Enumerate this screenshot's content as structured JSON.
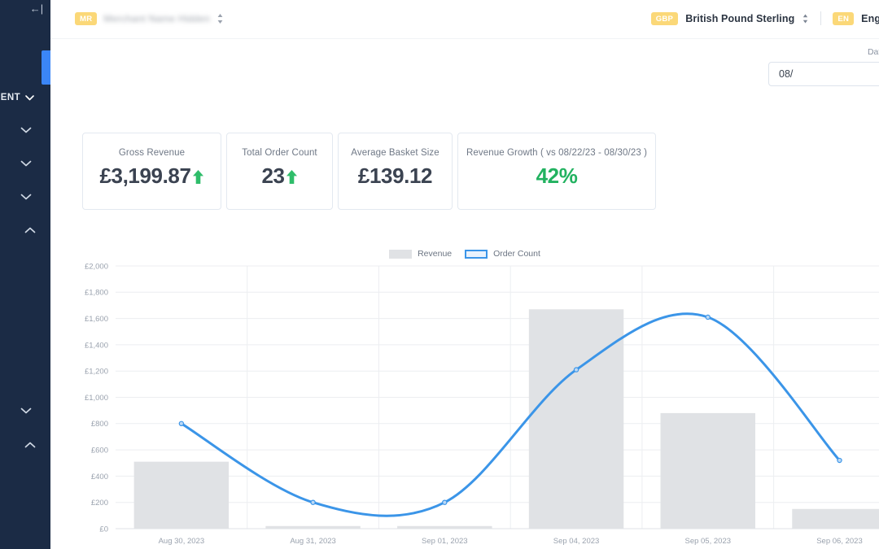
{
  "sidebar": {
    "collapse_icon": "collapse-sidebar-icon",
    "section_label": "ENT",
    "items": [
      {
        "name": "management-section",
        "chevron": "chevron-down"
      },
      {
        "name": "nav-group-2",
        "chevron": "chevron-down"
      },
      {
        "name": "nav-group-3",
        "chevron": "chevron-down"
      },
      {
        "name": "nav-group-4",
        "chevron": "chevron-down"
      },
      {
        "name": "nav-group-5",
        "chevron": "chevron-up"
      },
      {
        "name": "nav-group-6",
        "chevron": "chevron-down"
      },
      {
        "name": "nav-group-7",
        "chevron": "chevron-up"
      }
    ],
    "accent_color": "#3b86f7",
    "background_color": "#1b2b45"
  },
  "topbar": {
    "merchant_badge": "MR",
    "merchant_name": "Merchant Name Hidden",
    "currency_badge": "GBP",
    "currency_label": "British Pound Sterling",
    "language_badge": "EN",
    "language_label": "English"
  },
  "filters": {
    "date_range_label": "Date Range",
    "date_range_value": "08/"
  },
  "kpis": [
    {
      "title": "Gross Revenue",
      "value": "£3,199.87",
      "trend": "up",
      "color": "#3b4351"
    },
    {
      "title": "Total Order Count",
      "value": "23",
      "trend": "up",
      "color": "#3b4351"
    },
    {
      "title": "Average Basket Size",
      "value": "£139.12",
      "trend": "none",
      "color": "#3b4351"
    },
    {
      "title": "Revenue Growth ( vs 08/22/23 - 08/30/23 )",
      "value": "42%",
      "trend": "none",
      "color": "#22b260"
    }
  ],
  "chart_data": {
    "type": "bar",
    "title": "",
    "xlabel": "",
    "ylabel": "",
    "categories": [
      "Aug 30, 2023",
      "Aug 31, 2023",
      "Sep 01, 2023",
      "Sep 04, 2023",
      "Sep 05, 2023",
      "Sep 06, 2023"
    ],
    "ylim": [
      0,
      2000
    ],
    "ytick_labels": [
      "£0",
      "£200",
      "£400",
      "£600",
      "£800",
      "£1,000",
      "£1,200",
      "£1,400",
      "£1,600",
      "£1,800",
      "£2,000"
    ],
    "ytick_values": [
      0,
      200,
      400,
      600,
      800,
      1000,
      1200,
      1400,
      1600,
      1800,
      2000
    ],
    "grid": true,
    "legend_position": "top-center",
    "series": [
      {
        "name": "Revenue",
        "type": "bar",
        "color": "#e0e2e5",
        "values": [
          510,
          20,
          20,
          1670,
          880,
          150
        ]
      },
      {
        "name": "Order Count",
        "type": "line",
        "color": "#3b95e8",
        "values": [
          800,
          200,
          200,
          1210,
          1610,
          520
        ]
      }
    ]
  }
}
